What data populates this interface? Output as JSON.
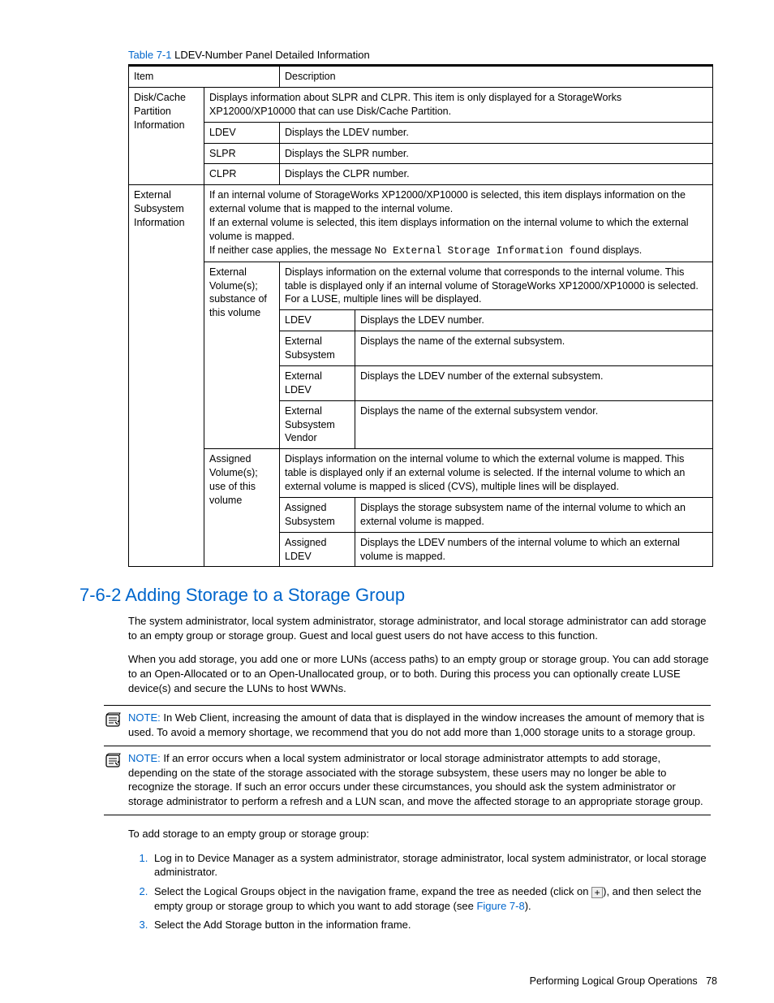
{
  "table": {
    "caption_ref": "Table 7-1",
    "caption_title": "LDEV-Number Panel Detailed Information",
    "header": {
      "item": "Item",
      "description": "Description"
    },
    "rows": {
      "diskcache": {
        "item": "Disk/Cache Partition Information",
        "desc": "Displays information about SLPR and CLPR. This item is only displayed for a StorageWorks XP12000/XP10000 that can use Disk/Cache Partition.",
        "sub_ldev_item": "LDEV",
        "sub_ldev_desc": "Displays the LDEV number.",
        "sub_slpr_item": "SLPR",
        "sub_slpr_desc": "Displays the SLPR number.",
        "sub_clpr_item": "CLPR",
        "sub_clpr_desc": "Displays the CLPR number."
      },
      "ext": {
        "item": "External Subsystem Information",
        "desc_pre": "If an internal volume of StorageWorks XP12000/XP10000 is selected, this item displays information on the external volume that is mapped to the internal volume.\nIf an external volume is selected, this item displays information on the internal volume to which the external volume is mapped.\nIf neither case applies, the message ",
        "desc_code": "No External Storage Information found",
        "desc_post": " displays.",
        "extvol": {
          "item": "External Volume(s); substance of this volume",
          "desc": "Displays information on the external volume that corresponds to the internal volume. This table is displayed only if an internal volume of StorageWorks XP12000/XP10000 is selected. For a LUSE, multiple lines will be displayed.",
          "ldev_item": "LDEV",
          "ldev_desc": "Displays the LDEV number.",
          "extsub_item": "External Subsystem",
          "extsub_desc": "Displays the name of the external subsystem.",
          "extldev_item": "External LDEV",
          "extldev_desc": "Displays the LDEV number of the external subsystem.",
          "vendor_item": "External Subsystem Vendor",
          "vendor_desc": "Displays the name of the external subsystem vendor."
        },
        "assigned": {
          "item": "Assigned Volume(s); use of this volume",
          "desc": "Displays information on the internal volume to which the external volume is mapped. This table is displayed only if an external volume is selected. If the internal volume to which an external volume is mapped is sliced (CVS), multiple lines will be displayed.",
          "sub_item": "Assigned Subsystem",
          "sub_desc": "Displays the storage subsystem name of the internal volume to which an external volume is mapped.",
          "ldev_item": "Assigned LDEV",
          "ldev_desc": "Displays the LDEV numbers of the internal volume to which an external volume is mapped."
        }
      }
    }
  },
  "section": {
    "heading": "7-6-2 Adding Storage to a Storage Group",
    "p1": "The system administrator, local system administrator, storage administrator, and local storage administrator can add storage to an empty group or storage group. Guest and local guest users do not have access to this function.",
    "p2": "When you add storage, you add one or more LUNs (access paths) to an empty group or storage group. You can add storage to an Open-Allocated or to an Open-Unallocated group, or to both. During this process you can optionally create LUSE device(s) and secure the LUNs to host WWNs.",
    "note1_label": "NOTE:",
    "note1": "  In Web Client, increasing the amount of data that is displayed in the window increases the amount of memory that is used. To avoid a memory shortage, we recommend that you do not add more than 1,000 storage units to a storage group.",
    "note2_label": "NOTE:",
    "note2": "  If an error occurs when a local system administrator or local storage administrator attempts to add storage, depending on the state of the storage associated with the storage subsystem, these users may no longer be able to recognize the storage. If such an error occurs under these circumstances, you should ask the system administrator or storage administrator to perform a refresh and a LUN scan, and move the affected storage to an appropriate storage group.",
    "intro_steps": "To add storage to an empty group or storage group:",
    "step1": "Log in to Device Manager as a system administrator, storage administrator, local system administrator, or local storage administrator.",
    "step2_pre": "Select the Logical Groups object in the navigation frame, expand the tree as needed (click on ",
    "step2_icon": "+",
    "step2_mid": "), and then select the empty group or storage group to which you want to add storage (see ",
    "step2_figref": "Figure 7-8",
    "step2_post": ").",
    "step3": "Select the Add Storage button in the information frame."
  },
  "footer": {
    "text": "Performing Logical Group Operations",
    "page": "78"
  }
}
